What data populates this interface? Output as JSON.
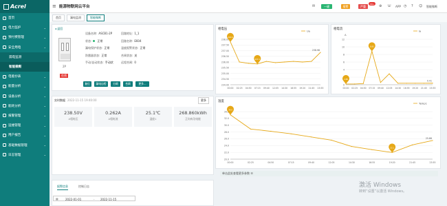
{
  "brand": "Acrel",
  "app_title": "能源物联网云平台",
  "sidebar": [
    {
      "label": "首页",
      "type": "item"
    },
    {
      "label": "电力监护",
      "type": "group"
    },
    {
      "label": "预付费管理",
      "type": "group"
    },
    {
      "label": "安全用电",
      "type": "group"
    },
    {
      "label": "漏电监测",
      "type": "sub"
    },
    {
      "label": "智能微断",
      "type": "sub-active"
    },
    {
      "label": "电能抄表",
      "type": "group"
    },
    {
      "label": "能量分析",
      "type": "group"
    },
    {
      "label": "设备分析",
      "type": "group"
    },
    {
      "label": "能耗分析",
      "type": "group"
    },
    {
      "label": "报警管理",
      "type": "group"
    },
    {
      "label": "运维管理",
      "type": "group"
    },
    {
      "label": "用户报告",
      "type": "group"
    },
    {
      "label": "基础数据管理",
      "type": "group"
    },
    {
      "label": "日志管理",
      "type": "group"
    }
  ],
  "header": {
    "btn1": "一键",
    "btn2": "报警",
    "btn3": "严重",
    "count": "99+",
    "app": "APP",
    "user": "智能微断"
  },
  "breadcrumb": [
    "首页",
    "漏电监测",
    "智能微断"
  ],
  "device": {
    "back": "返回",
    "name": "2P",
    "status_tag": "在线",
    "fields": [
      {
        "k": "设备名称:",
        "v": "ASCB1-2P"
      },
      {
        "k": "回路地址:",
        "v": "1_1"
      },
      {
        "k": "状态:",
        "v": "正常"
      },
      {
        "k": "回路名称:",
        "v": "E604"
      },
      {
        "k": "漏电保护状态:",
        "v": "正常"
      },
      {
        "k": "温度报警状态:",
        "v": "正常"
      },
      {
        "k": "防雷器状态:",
        "v": "正常"
      },
      {
        "k": "合闸状态:",
        "v": "关"
      },
      {
        "k": "手动/自动状态:",
        "v": "手动状"
      },
      {
        "k": "远程合闸:",
        "v": "0"
      }
    ],
    "buttons": [
      "复位",
      "漏电自检",
      "分闸",
      "合闸",
      "更多..."
    ]
  },
  "realtime": {
    "title": "实时数据",
    "time": "2022-11-15 19:40:00",
    "more": "更多",
    "cards": [
      {
        "v": "238.50V",
        "n": "A相电压"
      },
      {
        "v": "0.262A",
        "n": "A相电流"
      },
      {
        "v": "25.1℃",
        "n": "温度1"
      },
      {
        "v": "268.860kWh",
        "n": "正向有功电能"
      }
    ]
  },
  "bottom": {
    "tab1": "报警信息",
    "tab2": "控制日志",
    "date_from": "2022-01-01",
    "date_sep": "-",
    "date_to": "2022-11-15"
  },
  "footer_note": "单击此处查看更多参数",
  "watermark": {
    "line1": "激活 Windows",
    "line2": "转到“设置”以激活 Windows。"
  },
  "charts": [
    {
      "title": "相电压",
      "legend": "Ua",
      "unit": "V",
      "yticks": [
        "238.00",
        "237.50",
        "237.00",
        "236.50",
        "236.00",
        "235.50",
        "235.00",
        "234.50",
        "234.00"
      ],
      "xticks": [
        "00:00",
        "02:25",
        "04:50",
        "07:15",
        "09:40",
        "12:05",
        "14:30",
        "16:55",
        "19:20",
        "21:45",
        "23:55"
      ],
      "markers": [
        "240.6",
        "237.2"
      ],
      "end_label": "238.98",
      "color": "#e6a817"
    },
    {
      "title": "相电流",
      "legend": "Ia",
      "unit": "A",
      "yticks": [
        "12",
        "10",
        "8",
        "6",
        "4",
        "2",
        "0"
      ],
      "xticks": [
        "00:00",
        "02:25",
        "04:50",
        "07:15",
        "09:40",
        "12:05",
        "14:30",
        "16:55",
        "19:20",
        "21:45",
        "23:55"
      ],
      "markers": [
        "8.85",
        "2.88"
      ],
      "end_label": "0.41",
      "color": "#e6a817"
    },
    {
      "title": "温度",
      "legend": "Temp1",
      "unit": "℃",
      "yticks": [
        "34.0",
        "32.0",
        "30.0",
        "28.0",
        "26.0",
        "24.0",
        "22.0",
        "20.0"
      ],
      "xticks": [
        "00:00",
        "02:25",
        "04:50",
        "07:15",
        "09:40",
        "12:05",
        "14:30",
        "16:55",
        "19:20",
        "21:45",
        "23:55"
      ],
      "markers": [
        "34.0",
        "22.1"
      ],
      "end_label": "25.88",
      "color": "#e6a817"
    }
  ],
  "chart_data": [
    {
      "type": "line",
      "title": "相电压",
      "series": [
        {
          "name": "Ua",
          "x": [
            "00:00",
            "02:25",
            "04:50",
            "07:15",
            "09:40",
            "12:05",
            "14:30",
            "16:55",
            "19:20",
            "21:45",
            "23:55"
          ],
          "values": [
            240.6,
            237.5,
            237.3,
            237.2,
            237.6,
            237.4,
            237.5,
            237.6,
            237.5,
            237.6,
            238.98
          ]
        }
      ],
      "ylim": [
        234,
        241
      ]
    },
    {
      "type": "line",
      "title": "相电流",
      "series": [
        {
          "name": "Ia",
          "x": [
            "00:00",
            "02:25",
            "04:50",
            "07:15",
            "09:40",
            "12:05",
            "14:30",
            "16:55",
            "19:20",
            "21:45",
            "23:55"
          ],
          "values": [
            0.2,
            0.2,
            0.3,
            8.85,
            0.6,
            2.88,
            0.4,
            0.4,
            0.4,
            0.4,
            0.41
          ]
        }
      ],
      "ylim": [
        0,
        12
      ]
    },
    {
      "type": "line",
      "title": "温度",
      "series": [
        {
          "name": "Temp1",
          "x": [
            "00:00",
            "02:25",
            "04:50",
            "07:15",
            "09:40",
            "12:05",
            "14:30",
            "16:55",
            "19:20",
            "21:45",
            "23:55"
          ],
          "values": [
            34.0,
            29.5,
            28.8,
            28.0,
            27.0,
            26.0,
            24.0,
            23.0,
            22.1,
            24.5,
            25.88
          ]
        }
      ],
      "ylim": [
        20,
        35
      ]
    }
  ]
}
